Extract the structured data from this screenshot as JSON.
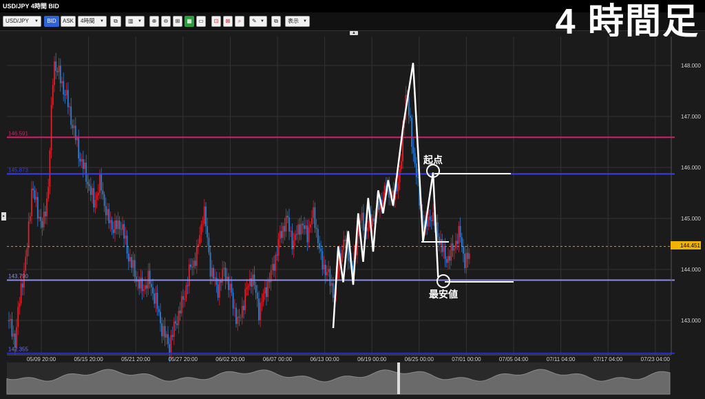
{
  "window": {
    "title": "USD/JPY 4時間 BID"
  },
  "toolbar": {
    "pair": "USD/JPY",
    "bid": "BID",
    "ask": "ASK",
    "period": "4時間",
    "display": "表示"
  },
  "overlay_title": "4 時間足",
  "annotations": {
    "start": "起点",
    "low": "最安値"
  },
  "chart_data": {
    "type": "candlestick",
    "y_ticks": [
      143.0,
      144.0,
      145.0,
      146.0,
      147.0,
      148.0
    ],
    "y_tick_labels": [
      "143.000",
      "144.000",
      "145.000",
      "146.000",
      "147.000",
      "148.000"
    ],
    "x_tick_labels": [
      "05/09 20:00",
      "05/15 20:00",
      "05/21 20:00",
      "05/27 20:00",
      "06/02 20:00",
      "06/07 00:00",
      "06/13 00:00",
      "06/19 00:00",
      "06/25 00:00",
      "07/01 00:00",
      "07/05 04:00",
      "07/11 04:00",
      "07/17 04:00",
      "07/23 04:00"
    ],
    "current_price": "144.451",
    "hlines": [
      {
        "label": "146.591",
        "value": 146.591,
        "color": "#d61f69"
      },
      {
        "label": "145.873",
        "value": 145.873,
        "color": "#3a3df0"
      },
      {
        "label": "143.790",
        "value": 143.79,
        "color": "#8f8fe8"
      },
      {
        "label": "142.355",
        "value": 142.355,
        "color": "#2a2ad8"
      }
    ],
    "colors": {
      "up": "#e0202a",
      "down": "#2a7fd8",
      "background": "#1b1b1b",
      "grid": "#333333",
      "zigzag": "#ffffff"
    },
    "zigzag": [
      [
        0.0,
        142.85
      ],
      [
        0.5,
        144.45
      ],
      [
        1.0,
        143.75
      ],
      [
        1.5,
        144.75
      ],
      [
        2.0,
        143.7
      ],
      [
        2.5,
        145.1
      ],
      [
        3.0,
        144.15
      ],
      [
        3.5,
        145.4
      ],
      [
        4.0,
        144.35
      ],
      [
        4.5,
        145.55
      ],
      [
        5.0,
        145.1
      ],
      [
        5.5,
        145.75
      ],
      [
        6.0,
        145.25
      ],
      [
        7.0,
        146.8
      ],
      [
        8.0,
        148.05
      ],
      [
        9.0,
        144.55
      ],
      [
        10.0,
        145.9
      ],
      [
        10.5,
        143.85
      ]
    ]
  }
}
